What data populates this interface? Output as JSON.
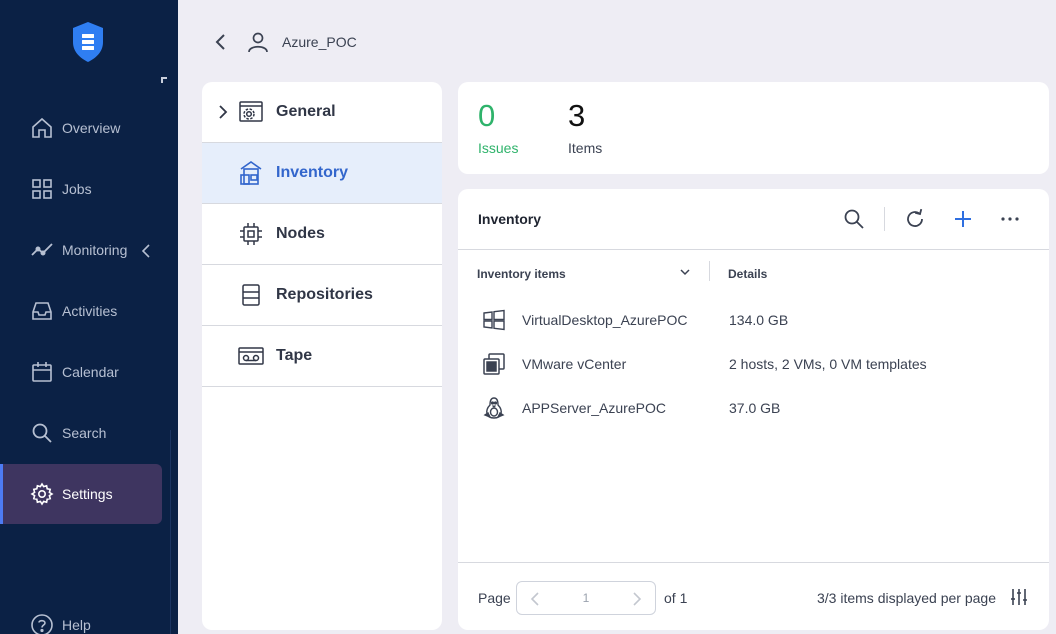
{
  "sidebar": {
    "items": [
      {
        "label": "Overview",
        "icon": "home-icon"
      },
      {
        "label": "Jobs",
        "icon": "grid-icon"
      },
      {
        "label": "Monitoring",
        "icon": "chart-line-icon"
      },
      {
        "label": "Activities",
        "icon": "inbox-icon"
      },
      {
        "label": "Calendar",
        "icon": "calendar-icon"
      },
      {
        "label": "Search",
        "icon": "search-icon"
      },
      {
        "label": "Settings",
        "icon": "gear-icon"
      },
      {
        "label": "Help",
        "icon": "help-icon"
      }
    ],
    "active": "Settings"
  },
  "header": {
    "breadcrumb": "Azure_POC"
  },
  "settings_menu": {
    "items": [
      {
        "label": "General",
        "icon": "settings-panel-icon"
      },
      {
        "label": "Inventory",
        "icon": "inventory-icon"
      },
      {
        "label": "Nodes",
        "icon": "chip-icon"
      },
      {
        "label": "Repositories",
        "icon": "database-icon"
      },
      {
        "label": "Tape",
        "icon": "tape-icon"
      }
    ],
    "active": "Inventory"
  },
  "stats": {
    "issues_value": "0",
    "issues_label": "Issues",
    "items_value": "3",
    "items_label": "Items"
  },
  "inventory": {
    "title": "Inventory",
    "columns": {
      "items": "Inventory items",
      "details": "Details"
    },
    "rows": [
      {
        "name": "VirtualDesktop_AzurePOC",
        "details": "134.0 GB",
        "icon": "windows-icon"
      },
      {
        "name": "VMware vCenter",
        "details": "2 hosts, 2 VMs, 0 VM templates",
        "icon": "vmware-icon"
      },
      {
        "name": "APPServer_AzurePOC",
        "details": "37.0 GB",
        "icon": "linux-icon"
      }
    ]
  },
  "pagination": {
    "page_label": "Page",
    "current_page": "1",
    "of_label": "of 1",
    "display_text": "3/3 items displayed per page"
  },
  "colors": {
    "sidebar_bg": "#0b2145",
    "active_nav_bg": "#3e3560",
    "accent": "#3366cc",
    "issues_green": "#2fb36b"
  }
}
